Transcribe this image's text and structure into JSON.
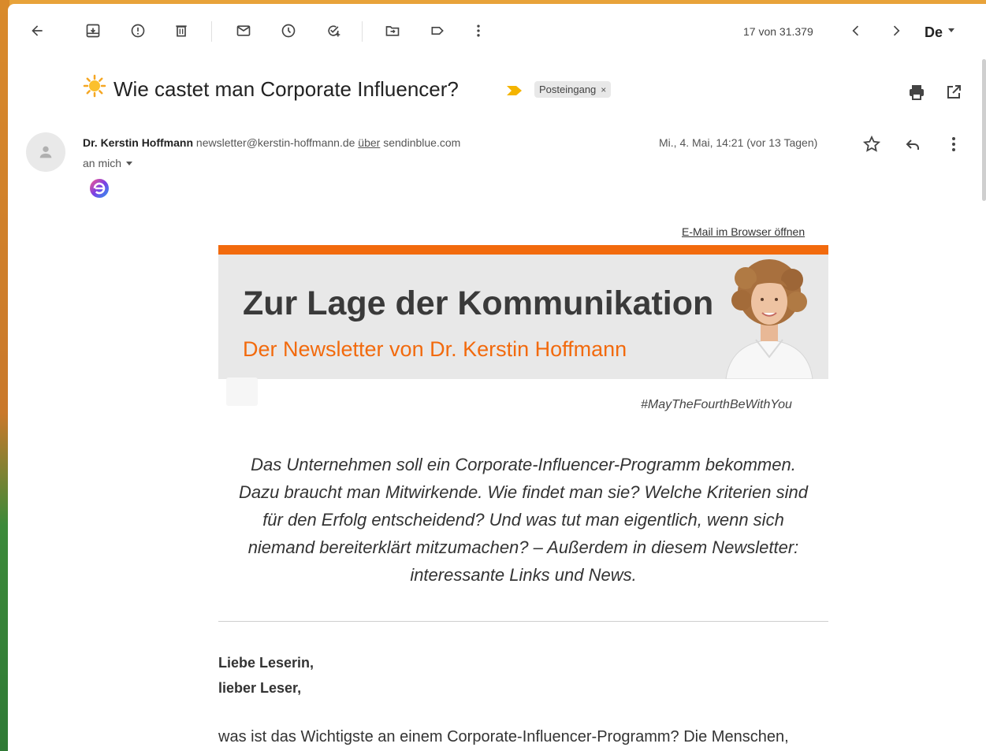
{
  "toolbar": {
    "icons": [
      "back-arrow-icon",
      "archive-icon",
      "report-spam-icon",
      "delete-icon",
      "mark-unread-icon",
      "snooze-icon",
      "add-task-icon",
      "move-to-icon",
      "label-icon",
      "more-vert-icon"
    ],
    "counter": "17 von 31.379",
    "language": "De"
  },
  "message": {
    "subject": "Wie castet man Corporate Influencer?",
    "label": "Posteingang",
    "label_remove": "×",
    "sender_name": "Dr. Kerstin Hoffmann",
    "sender_email": "newsletter@kerstin-hoffmann.de",
    "via_word": "über",
    "via_domain": "sendinblue.com",
    "to": "an mich",
    "date": "Mi., 4. Mai, 14:21 (vor 13 Tagen)"
  },
  "newsletter": {
    "browser_link": "E-Mail im Browser öffnen",
    "banner_title": "Zur Lage der Kommunikation",
    "banner_subtitle": "Der Newsletter von Dr. Kerstin Hoffmann",
    "hashtag": "#MayTheFourthBeWithYou",
    "lead_lines": [
      "Das Unternehmen soll ein Corporate-Influencer-Programm bekommen.",
      "Dazu braucht man Mitwirkende. Wie findet man sie? Welche Kriterien sind",
      "für den Erfolg entscheidend? Und was tut man eigentlich, wenn sich",
      "niemand bereiterklärt mitzumachen? – Außerdem in diesem Newsletter:",
      "interessante Links und News."
    ],
    "greeting_1": "Liebe Leserin,",
    "greeting_2": "lieber Leser,",
    "body_1": "was ist das Wichtigste an einem Corporate-Influencer-Programm? Die Menschen,"
  },
  "colors": {
    "accent_orange": "#f26a0d",
    "banner_bg": "#e8e8e8",
    "important_marker": "#f4b400"
  }
}
